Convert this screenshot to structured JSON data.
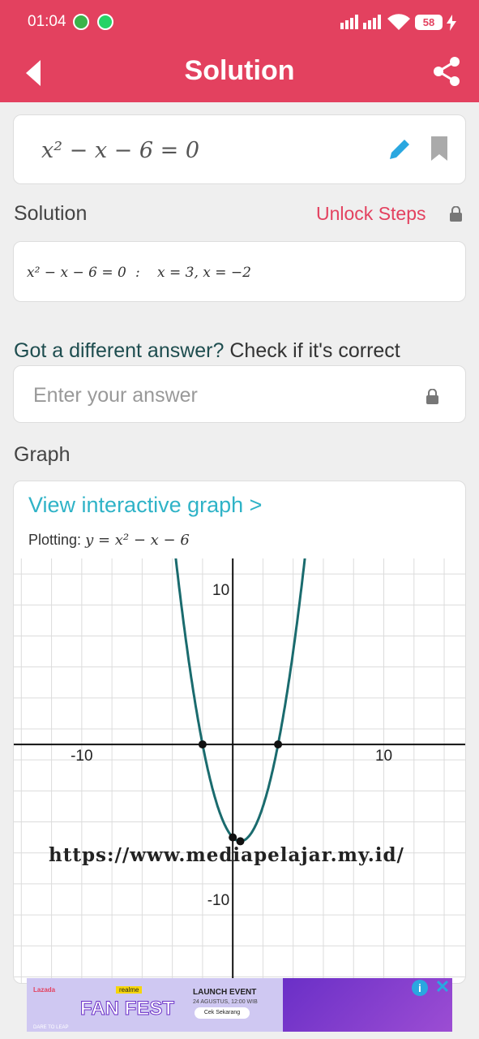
{
  "status_bar": {
    "time": "01:04",
    "battery": "58"
  },
  "app_bar": {
    "title": "Solution"
  },
  "equation_card": {
    "equation": "x² − x − 6 = 0"
  },
  "solution": {
    "label": "Solution",
    "unlock_label": "Unlock Steps",
    "result_left": "x² − x − 6 = 0",
    "separator": ":",
    "result_right": "x = 3, x = −2"
  },
  "answer_check": {
    "question_bold": "Got a different answer?",
    "question_rest": " Check if it's correct",
    "placeholder": "Enter your answer"
  },
  "graph": {
    "label": "Graph",
    "link": "View interactive graph >",
    "plotting_prefix": "Plotting:",
    "plotting_fn": "y = x² − x − 6",
    "tick_labels": {
      "x_neg": "-10",
      "x_pos": "10",
      "y_pos": "10",
      "y_neg": "-10"
    }
  },
  "chart_data": {
    "type": "line",
    "function": "y = x^2 - x - 6",
    "xlim": [
      -14.5,
      15.5
    ],
    "ylim": [
      -15.5,
      12
    ],
    "grid": true,
    "tick_labels": [
      "-10",
      "10",
      "10",
      "-10"
    ],
    "points": [
      {
        "x": -2,
        "y": 0
      },
      {
        "x": 3,
        "y": 0
      },
      {
        "x": 0,
        "y": -6
      },
      {
        "x": 0.5,
        "y": -6.25
      }
    ]
  },
  "watermark": "https://www.mediapelajar.my.id/",
  "ad": {
    "brand": "Lazada",
    "badge": "realme",
    "headline": "FAN FEST",
    "title": "LAUNCH EVENT",
    "subtitle": "24 AGUSTUS, 12:00 WIB",
    "cta": "Cek Sekarang",
    "tagline": "DARE TO LEAP",
    "colors": {
      "bg": "#cfc8f2",
      "accent": "#6a2fc7"
    }
  },
  "colors": {
    "brand": "#e3415f",
    "curve": "#1a6b6e",
    "link": "#2fb3c7"
  }
}
